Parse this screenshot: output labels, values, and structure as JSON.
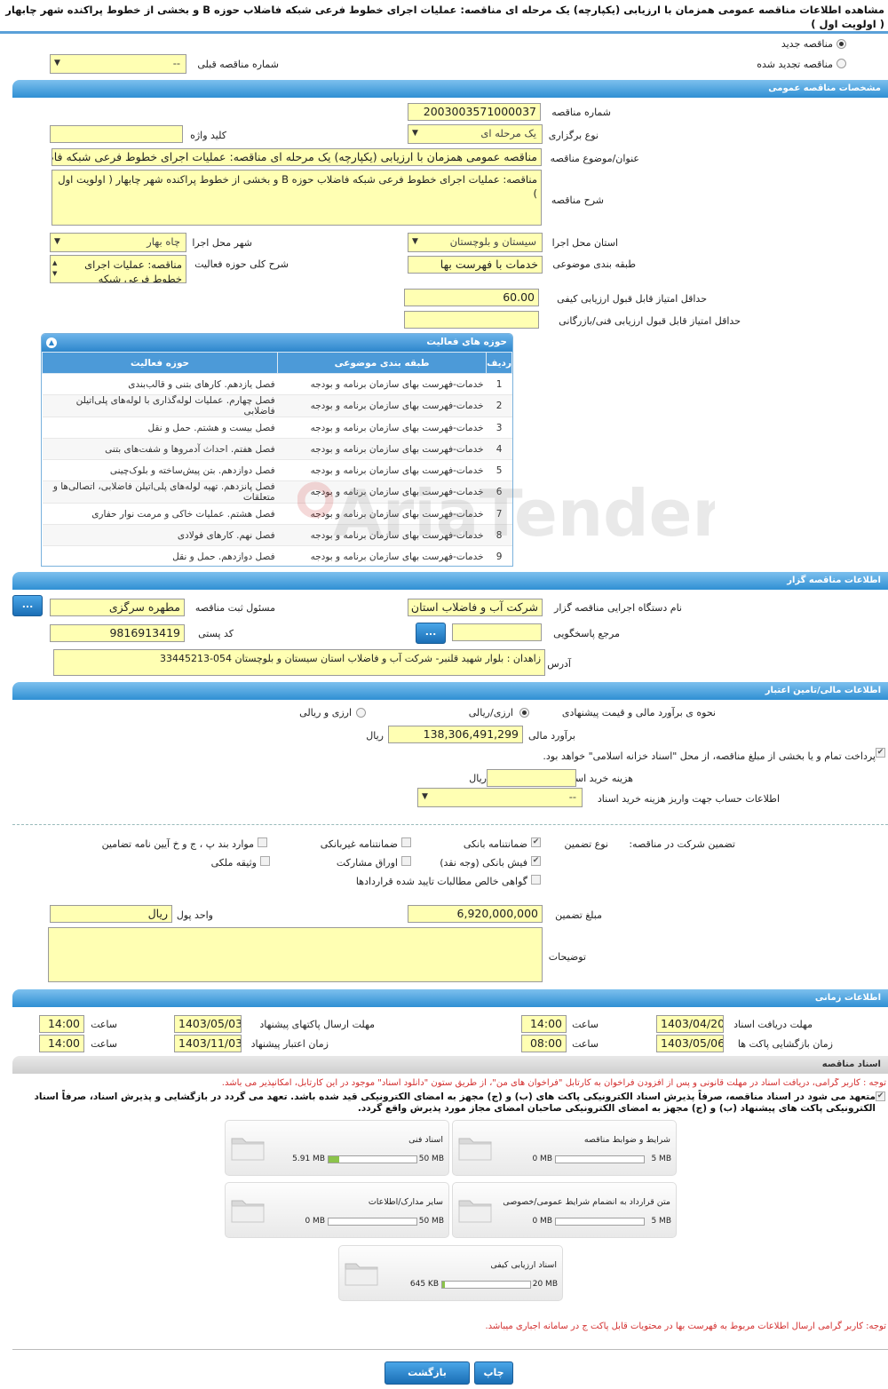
{
  "page_title": "مشاهده اطلاعات مناقصه عمومی همزمان با ارزیابی (یکپارچه) یک مرحله ای مناقصه: عملیات اجرای خطوط فرعی شبکه فاضلاب حوزه B و بخشی از خطوط پراکنده شهر چابهار ( اولویت اول )",
  "top": {
    "new_tender": "مناقصه جدید",
    "renewed_tender": "مناقصه تجدید شده",
    "prev_tender_label": "شماره مناقصه قبلی",
    "prev_tender_value": "--"
  },
  "general": {
    "header": "مشخصات مناقصه عمومی",
    "tender_no_label": "شماره مناقصه",
    "tender_no": "2003003571000037",
    "type_label": "نوع برگزاری",
    "type_value": "یک مرحله ای",
    "keyword_label": "کلید واژه",
    "keyword_value": "",
    "subject_label": "عنوان/موضوع مناقصه",
    "subject_value": "مناقصه عمومی همزمان با ارزیابی (یکپارچه) یک مرحله ای مناقصه: عملیات اجرای خطوط فرعی شبکه فاضلاب",
    "desc_label": "شرح مناقصه",
    "desc_value": "مناقصه: عملیات اجرای خطوط فرعی شبکه فاضلاب حوزه B و بخشی از خطوط پراکنده شهر چابهار ( اولویت اول )",
    "province_label": "استان محل اجرا",
    "province_value": "سیستان و بلوچستان",
    "city_label": "شهر محل اجرا",
    "city_value": "چاه بهار",
    "category_label": "طبقه بندی موضوعی",
    "category_value": "خدمات با فهرست بها",
    "scope_label": "شرح کلی حوزه فعالیت",
    "scope_value": "مناقصه: عملیات اجرای خطوط فرعی شبکه",
    "min_quality_label": "حداقل امتیاز قابل قبول ارزیابی کیفی",
    "min_quality_value": "60.00",
    "min_tech_label": "حداقل امتیاز قابل قبول ارزیابی فنی/بازرگانی",
    "min_tech_value": ""
  },
  "activities": {
    "header": "حوزه های فعالیت",
    "col_row": "ردیف",
    "col_category": "طبقه بندی موضوعی",
    "col_scope": "حوزه فعالیت",
    "rows": [
      {
        "n": "1",
        "cat": "خدمات-فهرست بهای سازمان برنامه و بودجه",
        "scope": "فصل یازدهم. کارهای بتنی و قالب‌بندی"
      },
      {
        "n": "2",
        "cat": "خدمات-فهرست بهای سازمان برنامه و بودجه",
        "scope": "فصل چهارم. عملیات لوله‌گذاری با لوله‌های پلی‌اتیلن فاضلابی"
      },
      {
        "n": "3",
        "cat": "خدمات-فهرست بهای سازمان برنامه و بودجه",
        "scope": "فصل بیست و هشتم. حمل و نقل"
      },
      {
        "n": "4",
        "cat": "خدمات-فهرست بهای سازمان برنامه و بودجه",
        "scope": "فصل هفتم. احداث آدمروها و شفت‌های بتنی"
      },
      {
        "n": "5",
        "cat": "خدمات-فهرست بهای سازمان برنامه و بودجه",
        "scope": "فصل دوازدهم. بتن پیش‌ساخته و بلوک‌چینی"
      },
      {
        "n": "6",
        "cat": "خدمات-فهرست بهای سازمان برنامه و بودجه",
        "scope": "فصل پانزدهم. تهیه لوله‌های پلی‌اتیلن فاضلابی، اتصالی‌ها و متعلقات"
      },
      {
        "n": "7",
        "cat": "خدمات-فهرست بهای سازمان برنامه و بودجه",
        "scope": "فصل هشتم. عملیات خاکی و مرمت نوار حفاری"
      },
      {
        "n": "8",
        "cat": "خدمات-فهرست بهای سازمان برنامه و بودجه",
        "scope": "فصل نهم. کارهای فولادی"
      },
      {
        "n": "9",
        "cat": "خدمات-فهرست بهای سازمان برنامه و بودجه",
        "scope": "فصل دوازدهم. حمل و نقل"
      }
    ]
  },
  "organizer": {
    "header": "اطلاعات مناقصه گزار",
    "org_label": "نام دستگاه اجرایی مناقصه گزار",
    "org_value": "شرکت آب و فاضلاب استان",
    "resp_label": "مسئول ثبت مناقصه",
    "resp_value": "مطهره سرگزی",
    "ref_label": "مرجع پاسخگویی",
    "ref_value": "",
    "postal_label": "کد پستی",
    "postal_value": "9816913419",
    "address_label": "آدرس",
    "address_value": "زاهدان : بلوار شهید قلنبر- شرکت آب و فاضلاب استان سیستان و بلوچستان 054-33445213",
    "dots": "..."
  },
  "finance": {
    "header": "اطلاعات مالی/تامین اعتبار",
    "method_label": "نحوه ی برآورد مالی و قیمت پیشنهادی",
    "opt_rial": "ارزی/ریالی",
    "opt_forex": "ارزی و ریالی",
    "estimate_label": "برآورد مالی",
    "estimate_value": "138,306,491,299",
    "rial": "ریال",
    "treasury_note": "پرداخت تمام و یا بخشی از مبلغ مناقصه، از محل \"اسناد خزانه اسلامی\" خواهد بود.",
    "doc_fee_label": "هزینه خرید اسناد",
    "doc_fee_value": "",
    "account_label": "اطلاعات حساب جهت واریز هزینه خرید اسناد",
    "account_value": "--"
  },
  "guarantee": {
    "title": "تضمین شرکت در مناقصه:",
    "type_label": "نوع تضمین",
    "bank_guarantee": "ضمانتنامه بانکی",
    "nonbank_guarantee": "ضمانتنامه غیربانکی",
    "items_bcd": "موارد بند پ ، ج و خ آیین نامه تضامین",
    "bank_receipt": "فیش بانکی (وجه نقد)",
    "bonds": "اوراق مشارکت",
    "property": "وثیقه ملکی",
    "claims": "گواهی خالص مطالبات تایید شده قراردادها",
    "amount_label": "مبلغ تضمین",
    "amount_value": "6,920,000,000",
    "currency_label": "واحد پول",
    "currency_value": "ریال",
    "notes_label": "توضیحات",
    "notes_value": ""
  },
  "timing": {
    "header": "اطلاعات زمانی",
    "receive_label": "مهلت دریافت اسناد",
    "receive_date": "1403/04/20",
    "receive_time": "14:00",
    "send_label": "مهلت ارسال پاکتهای پیشنهاد",
    "send_date": "1403/05/03",
    "send_time": "14:00",
    "open_label": "زمان بازگشایی پاکت ها",
    "open_date": "1403/05/06",
    "open_time": "08:00",
    "valid_label": "زمان اعتبار پیشنهاد",
    "valid_date": "1403/11/03",
    "valid_time": "14:00",
    "time_label": "ساعت"
  },
  "documents": {
    "header": "اسناد مناقصه",
    "note1": "توجه : کاربر گرامی، دریافت اسناد در مهلت قانونی و پس از افزودن فراخوان به کارتابل \"فراخوان های من\"، از طریق ستون \"دانلود اسناد\" موجود در این کارتابل، امکانپذیر می باشد.",
    "note2": "متعهد می شود در اسناد مناقصه، صرفاً پذیرش اسناد الکترونیکی پاکت های (ب) و (ج) مجهز به امضای الکترونیکی قید شده باشد. تعهد می گردد در بازگشایی و پذیرش اسناد، صرفاً اسناد الکترونیکی پاکت های پیشنهاد (ب) و (ج) مجهز به امضای الکترونیکی صاحبان امضای مجاز مورد پذیرش واقع گردد.",
    "cards": [
      {
        "title": "شرایط و ضوابط مناقصه",
        "max": "5 MB",
        "cur": "0 MB",
        "fill": 0
      },
      {
        "title": "اسناد فنی",
        "max": "50 MB",
        "cur": "5.91 MB",
        "fill": 0.12
      },
      {
        "title": "متن قرارداد به انضمام شرایط عمومی/خصوصی",
        "max": "5 MB",
        "cur": "0 MB",
        "fill": 0
      },
      {
        "title": "سایر مدارک/اطلاعات",
        "max": "50 MB",
        "cur": "0 MB",
        "fill": 0
      },
      {
        "title": "اسناد ارزیابی کیفی",
        "max": "20 MB",
        "cur": "645 KB",
        "fill": 0.03
      }
    ],
    "note3": "توجه: کاربر گرامی ارسال اطلاعات مربوط به فهرست بها در محتویات قابل پاکت ج در سامانه اجباری میباشد."
  },
  "footer": {
    "print": "چاپ",
    "back": "بازگشت"
  },
  "watermark": "AriaTender.neT"
}
